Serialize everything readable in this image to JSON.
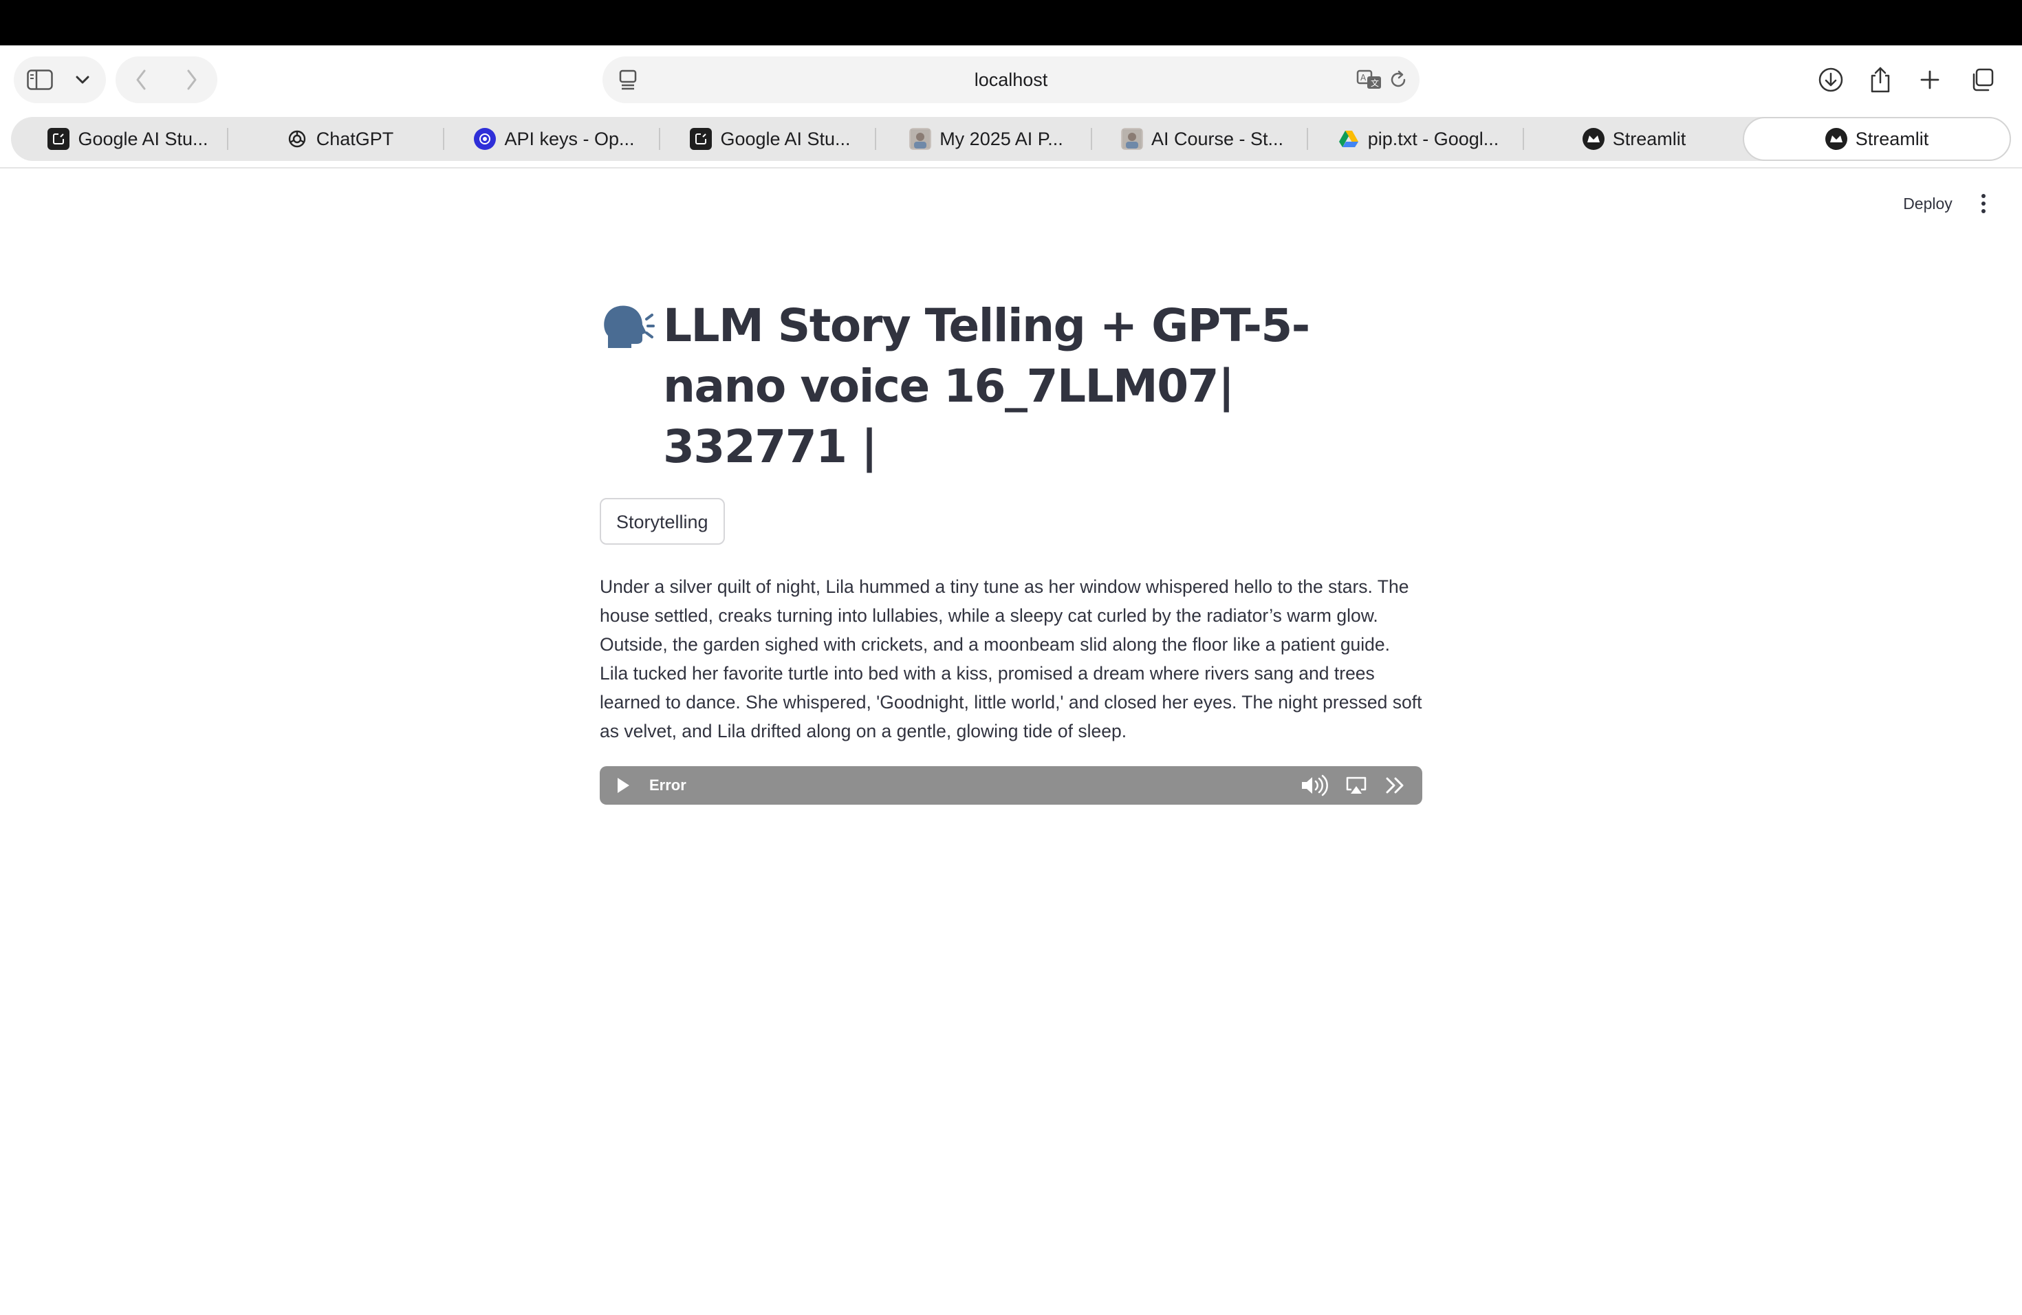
{
  "browser": {
    "url": "localhost",
    "tabs": [
      {
        "label": "Google AI Stu...",
        "icon": "google-ai-studio-icon",
        "active": false
      },
      {
        "label": "ChatGPT",
        "icon": "chatgpt-icon",
        "active": false
      },
      {
        "label": "API keys - Op...",
        "icon": "openai-icon",
        "active": false
      },
      {
        "label": "Google AI Stu...",
        "icon": "google-ai-studio-icon",
        "active": false
      },
      {
        "label": "My 2025 AI P...",
        "icon": "avatar-icon",
        "active": false
      },
      {
        "label": "AI Course - St...",
        "icon": "avatar-icon",
        "active": false
      },
      {
        "label": "pip.txt - Googl...",
        "icon": "google-drive-icon",
        "active": false
      },
      {
        "label": "Streamlit",
        "icon": "streamlit-icon",
        "active": false
      },
      {
        "label": "Streamlit",
        "icon": "streamlit-icon",
        "active": true
      }
    ]
  },
  "app": {
    "deploy_label": "Deploy",
    "title": "LLM Story Telling + GPT-5-nano voice 16_7LLM07| 332771 |",
    "title_icon": "speaking-head-icon",
    "tag_label": "Storytelling",
    "story": "Under a silver quilt of night, Lila hummed a tiny tune as her window whispered hello to the stars. The house settled, creaks turning into lullabies, while a sleepy cat curled by the radiator’s warm glow. Outside, the garden sighed with crickets, and a moonbeam slid along the floor like a patient guide. Lila tucked her favorite turtle into bed with a kiss, promised a dream where rivers sang and trees learned to dance. She whispered, 'Goodnight, little world,' and closed her eyes. The night pressed soft as velvet, and Lila drifted along on a gentle, glowing tide of sleep.",
    "audio": {
      "status": "Error"
    }
  },
  "colors": {
    "text": "#31333f",
    "audio_bar": "#8f8f8f",
    "tabbar": "#e7e7e7"
  }
}
